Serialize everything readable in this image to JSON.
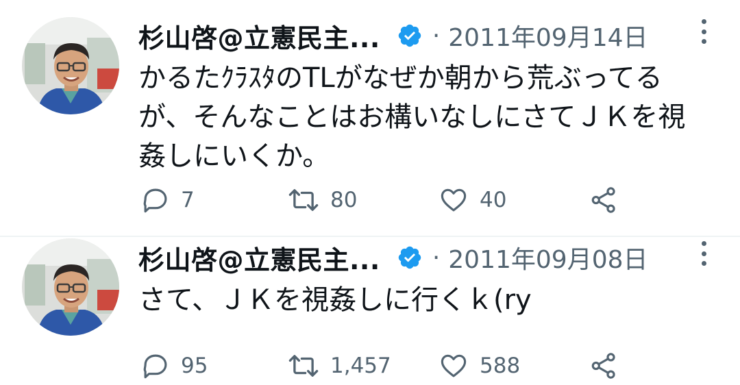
{
  "accent_color": "#1d9bf0",
  "tweets": [
    {
      "author": "杉山啓@立憲民主...",
      "verified_icon": "verified-badge-icon",
      "separator": "·",
      "date": "2011年09月14日",
      "text": "かるたｸﾗｽﾀのTLがなぜか朝から荒ぶってる\nが、そんなことはお構いなしにさてＪＫを視\n姦しにいくか。",
      "replies": "7",
      "retweets": "80",
      "likes": "40"
    },
    {
      "author": "杉山啓@立憲民主...",
      "verified_icon": "verified-badge-icon",
      "separator": "·",
      "date": "2011年09月08日",
      "text": "さて、ＪＫを視姦しに行くｋ(ry",
      "replies": "95",
      "retweets": "1,457",
      "likes": "588"
    }
  ]
}
